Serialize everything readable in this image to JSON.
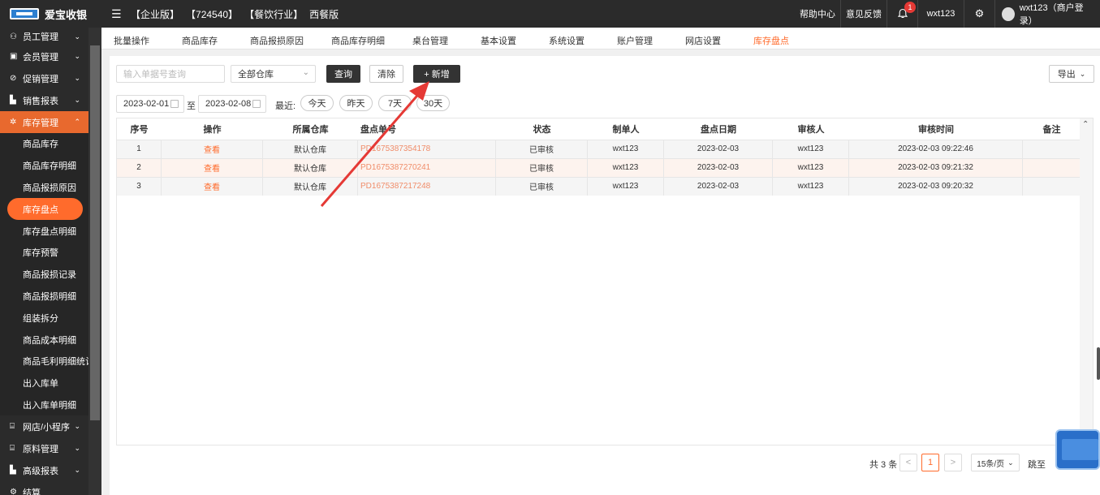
{
  "topbar": {
    "logo_text": "爱宝收银",
    "tags": [
      "【企业版】",
      "【724540】",
      "【餐饮行业】",
      "西餐版"
    ],
    "help": "帮助中心",
    "feedback": "意见反馈",
    "notification_count": "1",
    "username": "wxt123",
    "account": "wxt123（商户登录）"
  },
  "sidebar": {
    "groups_top": [
      {
        "label": "员工管理",
        "icon": "user-icon"
      },
      {
        "label": "会员管理",
        "icon": "member-icon"
      },
      {
        "label": "促销管理",
        "icon": "promo-icon"
      },
      {
        "label": "销售报表",
        "icon": "chart-icon"
      }
    ],
    "active_group": {
      "label": "库存管理",
      "icon": "inventory-icon"
    },
    "sub_items": [
      "商品库存",
      "商品库存明细",
      "商品报损原因",
      "库存盘点",
      "库存盘点明细",
      "库存预警",
      "商品报损记录",
      "商品报损明细",
      "组装拆分",
      "商品成本明细",
      "商品毛利明细统计",
      "出入库单",
      "出入库单明细"
    ],
    "current_sub": "库存盘点",
    "groups_bottom": [
      {
        "label": "网店/小程序",
        "icon": "store-icon"
      },
      {
        "label": "原料管理",
        "icon": "material-icon"
      },
      {
        "label": "高级报表",
        "icon": "report-icon"
      },
      {
        "label": "结算",
        "icon": "settle-icon"
      }
    ]
  },
  "tabs": [
    "批量操作",
    "商品库存",
    "商品报损原因",
    "商品库存明细",
    "桌台管理",
    "基本设置",
    "系统设置",
    "账户管理",
    "网店设置",
    "库存盘点"
  ],
  "active_tab": "库存盘点",
  "filters": {
    "search_placeholder": "输入单据号查询",
    "warehouse": "全部仓库",
    "query": "查询",
    "clear": "清除",
    "add": "+ 新增",
    "export": "导出",
    "date_from": "2023-02-01",
    "to": "至",
    "date_to": "2023-02-08",
    "recent": "最近:",
    "quick": [
      "今天",
      "昨天",
      "7天",
      "30天"
    ]
  },
  "table": {
    "headers": [
      "序号",
      "操作",
      "所属仓库",
      "盘点单号",
      "状态",
      "制单人",
      "盘点日期",
      "审核人",
      "审核时间",
      "备注"
    ],
    "rows": [
      [
        "1",
        "查看",
        "默认仓库",
        "PD1675387354178",
        "已审核",
        "wxt123",
        "2023-02-03",
        "wxt123",
        "2023-02-03 09:22:46",
        ""
      ],
      [
        "2",
        "查看",
        "默认仓库",
        "PD1675387270241",
        "已审核",
        "wxt123",
        "2023-02-03",
        "wxt123",
        "2023-02-03 09:21:32",
        ""
      ],
      [
        "3",
        "查看",
        "默认仓库",
        "PD1675387217248",
        "已审核",
        "wxt123",
        "2023-02-03",
        "wxt123",
        "2023-02-03 09:20:32",
        ""
      ]
    ]
  },
  "pagination": {
    "total": "共 3 条",
    "prev": "<",
    "page": "1",
    "next": ">",
    "page_size": "15条/页",
    "jump": "跳至"
  },
  "colors": {
    "accent": "#ff6b2c",
    "sidebar_bg": "#2b2b2b",
    "annotation_arrow": "#e53935"
  }
}
